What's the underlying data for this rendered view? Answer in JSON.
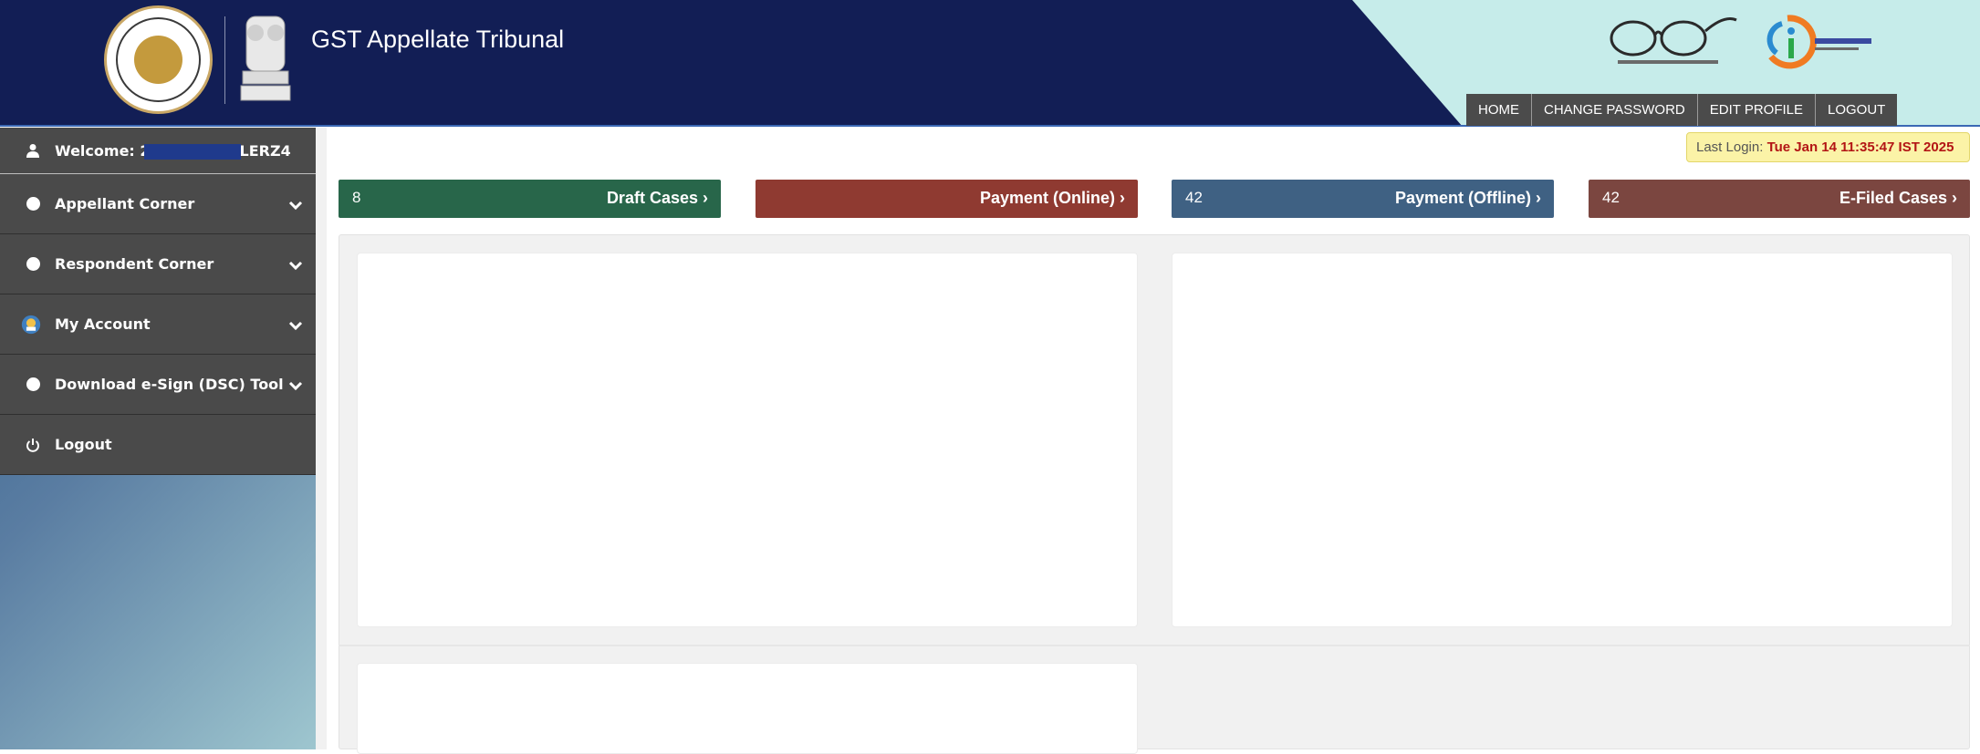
{
  "header": {
    "app_title": "GST Appellate Tribunal",
    "logos": [
      "gstat-seal-logo",
      "ashoka-emblem-logo",
      "swachh-bharat-logo",
      "digital-india-logo"
    ],
    "nav": [
      "HOME",
      "CHANGE PASSWORD",
      "EDIT PROFILE",
      "LOGOUT"
    ]
  },
  "sidebar": {
    "welcome_prefix": "Welcome: 2",
    "welcome_suffix": "LERZ4",
    "items": [
      {
        "label": "Appellant Corner",
        "icon": "dot-icon",
        "expandable": true
      },
      {
        "label": "Respondent Corner",
        "icon": "dot-icon",
        "expandable": true
      },
      {
        "label": "My Account",
        "icon": "avatar-icon",
        "expandable": true
      },
      {
        "label": "Download e-Sign (DSC) Tool",
        "icon": "dot-icon",
        "expandable": true
      },
      {
        "label": "Logout",
        "icon": "power-icon",
        "expandable": false
      }
    ]
  },
  "last_login": {
    "label": "Last Login: ",
    "value": "Tue Jan 14 11:35:47 IST 2025"
  },
  "stats": [
    {
      "count": "8",
      "title": "Draft Cases",
      "color": "#28664a"
    },
    {
      "count": "",
      "title": "Payment (Online)",
      "color": "#8f3a31"
    },
    {
      "count": "42",
      "title": "Payment (Offline)",
      "color": "#3f6183"
    },
    {
      "count": "42",
      "title": "E-Filed Cases",
      "color": "#7b4640"
    }
  ],
  "colors": {
    "header_bg": "#121e55",
    "header_accent": "#c6ecea",
    "sidebar_menu": "#4a4a4a",
    "nav_btn": "#4b4b4b",
    "last_login_bg": "#fbf3a7"
  }
}
